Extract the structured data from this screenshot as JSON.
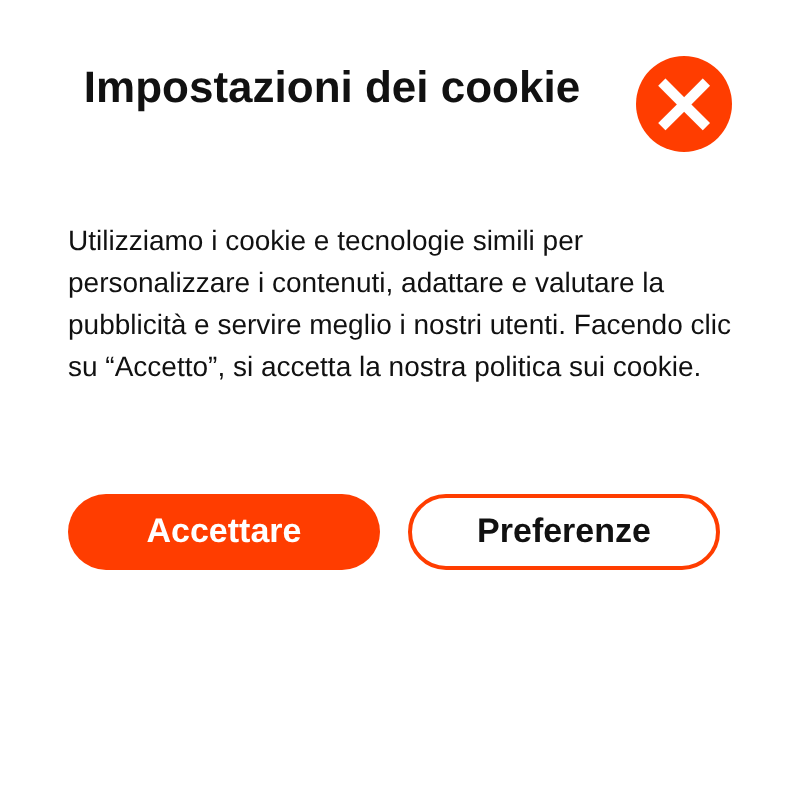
{
  "dialog": {
    "title": "Impostazioni dei cookie",
    "close_icon": "×",
    "message": "Utilizziamo i cookie e tecnologie simili per personalizzare i contenuti, adattare e valutare la pubblicità e servire meglio i nostri utenti. Facendo clic su “Accetto”, si accetta la nostra politica sui cookie.",
    "buttons": [
      {
        "label": "Accettare",
        "kind": "primary"
      },
      {
        "label": "Preferenze",
        "kind": "outline"
      }
    ]
  }
}
